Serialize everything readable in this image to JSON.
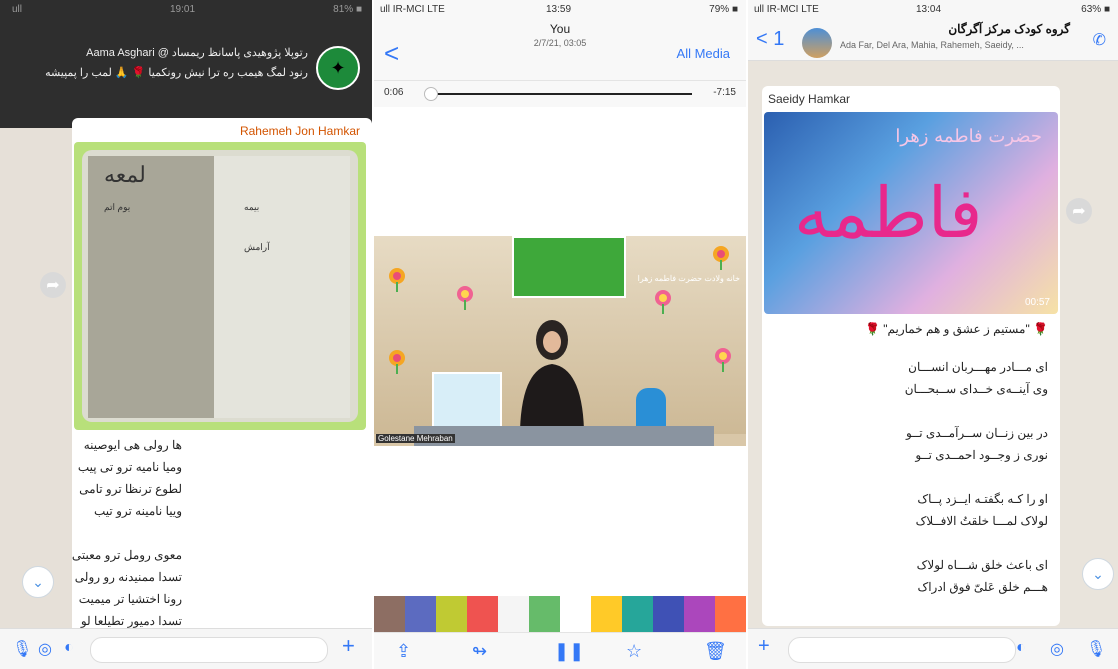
{
  "panel1": {
    "status_left": "ull",
    "status_time": "19:01",
    "status_right": "81% ■",
    "notification": {
      "line1": "Aama Asghari @ رتوپلا پژوهیدی پاسانظ ریمساد",
      "line2": "رنود لمگ هیمب ره ترا نیش رونکمیا 🌹 🙏 لمب را پمپیشه"
    },
    "sender": "Rahemeh Jon Hamkar",
    "poster_text": [
      "لمعه",
      "یوم اتم",
      "بیمه",
      "آرامش"
    ],
    "poem": [
      "ها رولی هی ایوصینه",
      "ومیا نامیه ترو تی پیب",
      "لطوع ترنظا ترو تامی",
      "وییا نامینه ترو تیب",
      "",
      "معوی رومل ترو معبتی",
      "تسدا ممنیدنه رو رولی",
      "رونا اختشیا تر میمیت",
      "تسدا دمیور تطیلعا لو"
    ],
    "bottom_icons": [
      "mic-icon",
      "camera-icon",
      "sticker-icon",
      "plus-icon"
    ],
    "colors": {
      "accent": "#3478f6",
      "sender": "#d35400"
    }
  },
  "panel2": {
    "status_left": "ull IR-MCI  LTE",
    "status_time": "13:59",
    "status_right": "79% ■",
    "back": "<",
    "title": "You",
    "subtitle": "2/7/21, 03:05",
    "all_media": "All Media",
    "elapsed": "0:06",
    "remaining": "-7:15",
    "video": {
      "channel_tag": "خانه ولادت حضرت فاطمه زهرا",
      "caption": "Golestane Mehraban"
    },
    "bottom_icons": [
      "share-icon",
      "forward-icon",
      "pause-icon",
      "star-icon",
      "trash-icon"
    ]
  },
  "panel3": {
    "status_left": "ull IR-MCI  LTE",
    "status_time": "13:04",
    "status_right": "63% ■",
    "back": "< 1",
    "group_title": "گروه کودک مرکز آگرگان",
    "group_members": "Ada Far, Del Ara, Mahia, Rahemeh, Saeidy, ...",
    "sender": "Saeidy Hamkar",
    "poster_big": "فاطمه",
    "poster_header": "حضرت فاطمه زهرا",
    "duration": "00:57",
    "poem": [
      "🌹 \"مستیم ز عشق و هم خماریم\" 🌹",
      "",
      "ای مـــادر مهـــربان انســـان",
      "وی آینــه‌ی خــدای ســبحـــان",
      "",
      "در بین زنــان ســرآمــدی تــو",
      "نوری ز وجــود احمــدی تــو",
      "",
      "او را کـه بگفتـه ایــزد پــاک",
      "لولاک لمـــا خلقتُ الافــلاک",
      "",
      "ای باعث خلق شـــاه لولاک",
      "هـــم خلق عَلیّ فوق ادراک"
    ],
    "bottom_icons": [
      "plus-icon",
      "sticker-icon",
      "camera-icon",
      "mic-icon"
    ]
  }
}
